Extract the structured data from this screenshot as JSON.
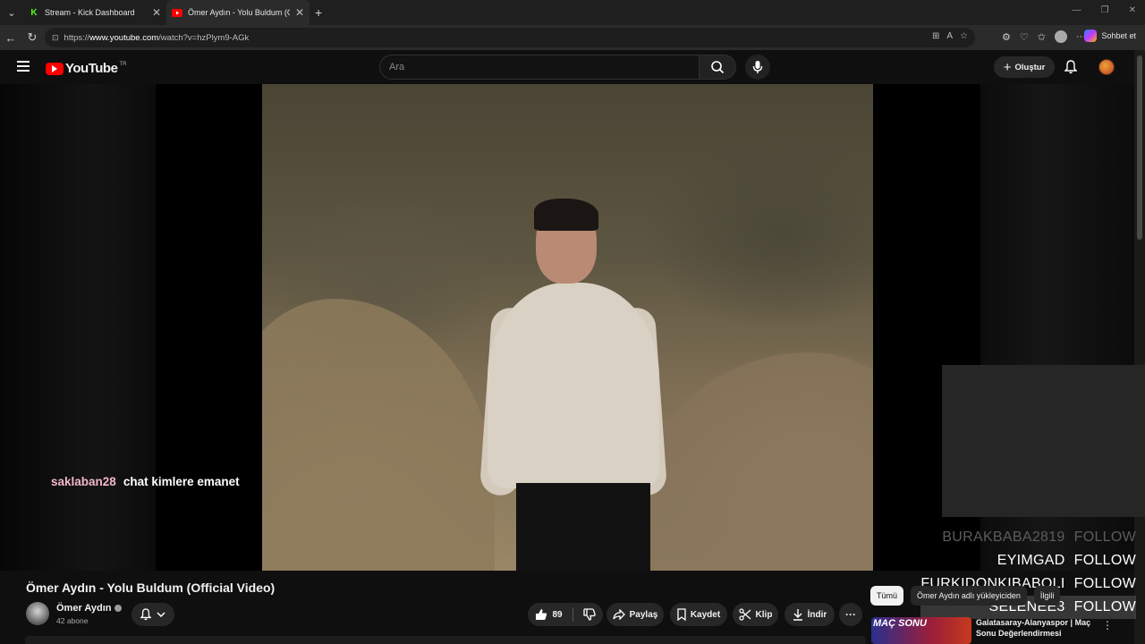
{
  "browser": {
    "tabs": [
      {
        "title": "Stream - Kick Dashboard",
        "icon": "kick-icon"
      },
      {
        "title": "Ömer Aydın - Yolu Buldum (Official Video)",
        "icon": "youtube-icon"
      }
    ],
    "url_prefix": "https://",
    "url_host": "www.youtube.com",
    "url_path": "/watch?v=hzPlym9-AGk",
    "copilot_label": "Sohbet et"
  },
  "youtube": {
    "logo_text": "YouTube",
    "country_code": "TR",
    "search_placeholder": "Ara",
    "create_label": "Oluştur"
  },
  "stream_overlay": {
    "chat": {
      "user": "saklaban28",
      "text": "chat kimlere emanet"
    },
    "follows": [
      {
        "name": "BURAKBABA2819",
        "tag": "FOLLOW"
      },
      {
        "name": "EYIMGAD",
        "tag": "FOLLOW"
      },
      {
        "name": "FURKIDONKIBABOLI",
        "tag": "FOLLOW"
      },
      {
        "name": "SELENEE3",
        "tag": "FOLLOW"
      }
    ]
  },
  "video": {
    "title": "Ömer Aydın - Yolu Buldum (Official Video)",
    "channel_name": "Ömer Aydın",
    "subscribers": "42 abone",
    "like_count": "89",
    "actions": {
      "share": "Paylaş",
      "save": "Kaydet",
      "clip": "Klip",
      "download": "İndir"
    }
  },
  "sidebar": {
    "chips": [
      "Tümü",
      "Ömer Aydın adlı yükleyiciden",
      "İlgili"
    ],
    "recommendation": {
      "thumb_label": "MAÇ SONU",
      "title": "Galatasaray-Alanyaspor | Maç Sonu Değerlendirmesi"
    }
  },
  "colors": {
    "youtube_red": "#ff0000",
    "chat_user": "#f2b7ca",
    "background": "#0f0f0f"
  }
}
